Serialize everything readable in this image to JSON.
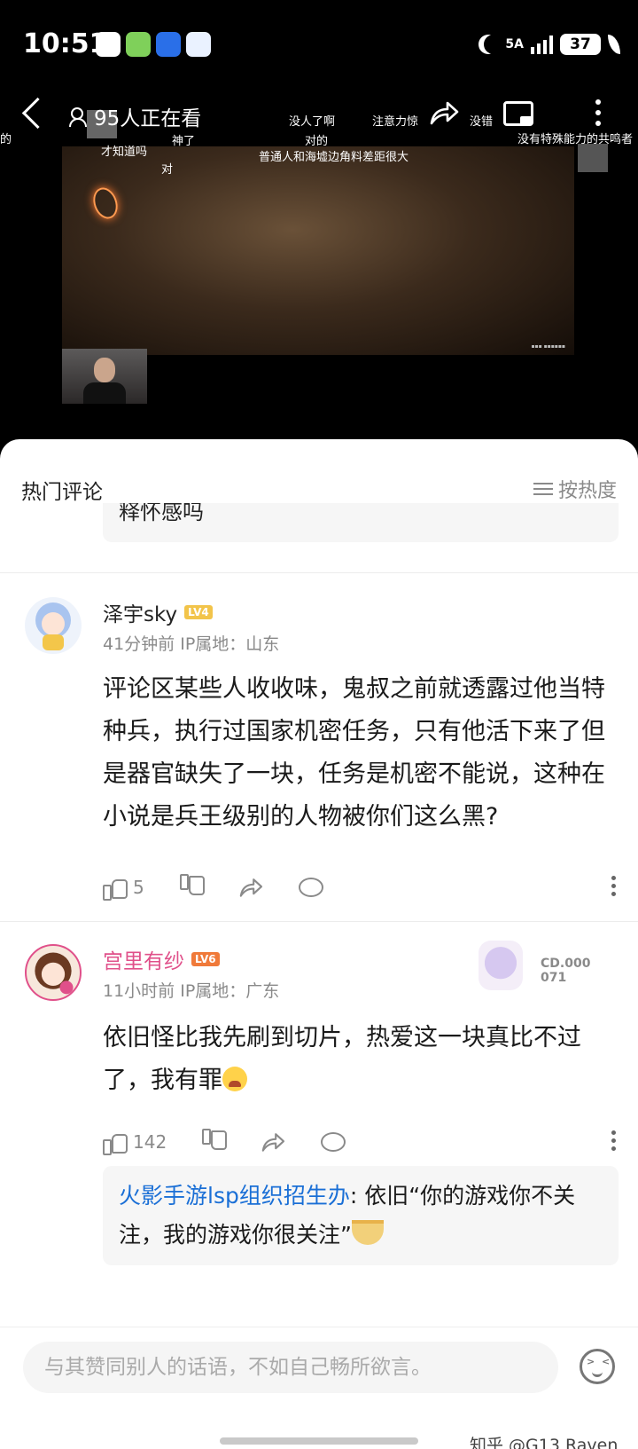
{
  "status_bar": {
    "time": "10:51",
    "network": "5A",
    "battery": "37"
  },
  "live": {
    "viewer_count": "95人正在看",
    "danmaku": [
      "没人了啊",
      "注意力惊",
      "没错",
      "神了",
      "才知道吗",
      "对的",
      "普通人和海墟边角料差距很大",
      "对",
      "没有特殊能力的共鸣者",
      "的"
    ]
  },
  "comments_header": {
    "title": "热门评论",
    "sort_label": "按热度"
  },
  "prev_reply_fragment": "释怀感吗",
  "comments": [
    {
      "username": "泽宇sky",
      "level": "LV4",
      "meta": "41分钟前 IP属地：山东",
      "text": "评论区某些人收收味，鬼叔之前就透露过他当特种兵，执行过国家机密任务，只有他活下来了但是器官缺失了一块，任务是机密不能说，这种在小说是兵王级别的人物被你们这么黑?",
      "likes": "5"
    },
    {
      "username": "宫里有纱",
      "level": "LV6",
      "meta": "11小时前 IP属地：广东",
      "text": "依旧怪比我先刷到切片，热爱这一块真比不过了，我有罪",
      "likes": "142",
      "deco_badge": "CD.000071",
      "reply": {
        "author": "火影手游lsp组织招生办",
        "text": ": 依旧“你的游戏你不关注，我的游戏你很关注”"
      }
    }
  ],
  "input": {
    "placeholder": "与其赞同别人的话语，不如自己畅所欲言。"
  },
  "credit": "知乎 @G13 Raven",
  "colors": {
    "accent_pink": "#e0508a",
    "link_blue": "#1a6fd6",
    "lv4": "#f2c44a",
    "lv6": "#f07a3a"
  }
}
